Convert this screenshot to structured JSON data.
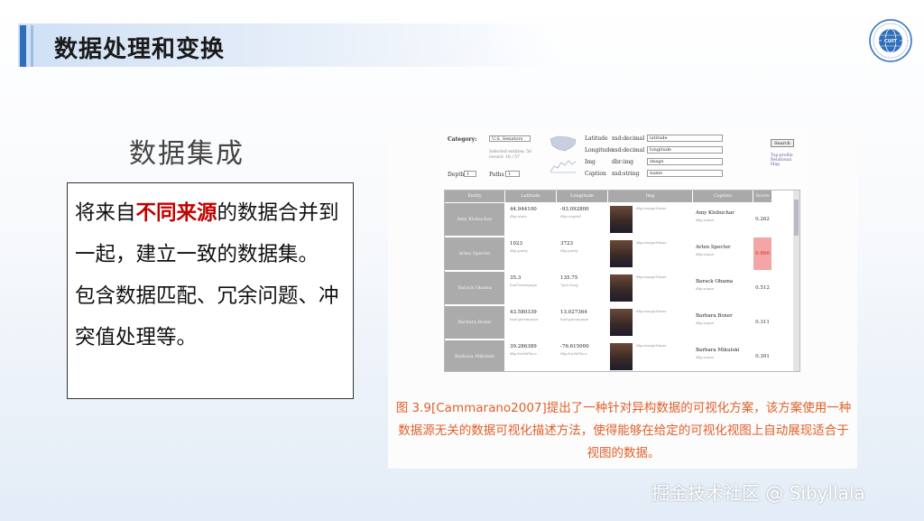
{
  "header": {
    "title": "数据处理和变换",
    "logo_text": "CUIT"
  },
  "subtitle": "数据集成",
  "description": {
    "prefix": "将来自",
    "highlight": "不同来源",
    "suffix": "的数据合并到一起，建立一致的数据集。",
    "line2": "包含数据匹配、冗余问题、冲突值处理等。"
  },
  "figure": {
    "form": {
      "category_label": "Category:",
      "category_value": "U.S. Senators",
      "selected_note": "Selected entities: 50",
      "selected_note2": "record: 18 / 57",
      "depth_label": "Depth",
      "depth_value": "1",
      "paths_label": "Paths",
      "paths_value": "1",
      "fields": [
        {
          "label": "Latitude",
          "type": "xsd:decimal",
          "value": "latitude"
        },
        {
          "label": "Longitude",
          "type": "xsd:decimal",
          "value": "longitude"
        },
        {
          "label": "Img",
          "type": "dbr:img",
          "value": "image"
        },
        {
          "label": "Caption",
          "type": "xsd:string",
          "value": "name"
        }
      ],
      "search_button": "Search",
      "links": [
        "Top-profile",
        "Relational",
        "Map"
      ]
    },
    "table": {
      "headers": [
        "Entity",
        "Latitude",
        "Longitude",
        "Img",
        "Caption",
        "Score"
      ],
      "rows": [
        {
          "name": "Amy Klobuchar",
          "lat": "44.944100",
          "lat_sub": "dbp:state",
          "lon": "-93.092800",
          "lon_sub": "dbp:capital",
          "img_note": "dbp:imageName",
          "caption": "Amy Klobuchar",
          "caption_sub": "dbp:name",
          "score": "0.262",
          "highlight": false
        },
        {
          "name": "Arlen Specter",
          "lat": "1023",
          "lat_sub": "dbp:party",
          "lon": "3723",
          "lon_sub": "dbp:party",
          "img_note": "dbp:imageName",
          "caption": "Arlen Specter",
          "caption_sub": "dbp:name",
          "score": "0.866",
          "highlight": true
        },
        {
          "name": "Barack Obama",
          "lat": "35.3",
          "lat_sub": "foaf:homepage",
          "lon": "135.75",
          "lon_sub": "*geo:long",
          "img_note": "dbp:imageName",
          "caption": "Barack Obama",
          "caption_sub": "dbp:name",
          "score": "0.512",
          "highlight": false
        },
        {
          "name": "Barbara Boxer",
          "lat": "43.580339",
          "lat_sub": "foaf:givenname",
          "lon": "13.027364",
          "lon_sub": "foaf:givenname",
          "img_note": "dbp:imageName",
          "caption": "Barbara Boxer",
          "caption_sub": "dbp:name",
          "score": "0.311",
          "highlight": false
        },
        {
          "name": "Barbara Mikulski",
          "lat": "39.286389",
          "lat_sub": "dbp:birthPlace",
          "lon": "-76.615000",
          "lon_sub": "dbp:birthPlace",
          "img_note": "dbp:imageName",
          "caption": "Barbara Mikulski",
          "caption_sub": "dbp:name",
          "score": "0.301",
          "highlight": false
        }
      ]
    },
    "caption": "图 3.9[Cammarano2007]提出了一种针对异构数据的可视化方案，该方案使用一种数据源无关的数据可视化描述方法，使得能够在给定的可视化视图上自动展现适合于视图的数据。"
  },
  "watermark": "掘金技术社区 @ Sibyllala",
  "colors": {
    "accent_blue": "#2f6fb9",
    "highlight_red": "#c00000",
    "caption_orange": "#e0602a",
    "score_highlight": "#f4a6a6"
  }
}
